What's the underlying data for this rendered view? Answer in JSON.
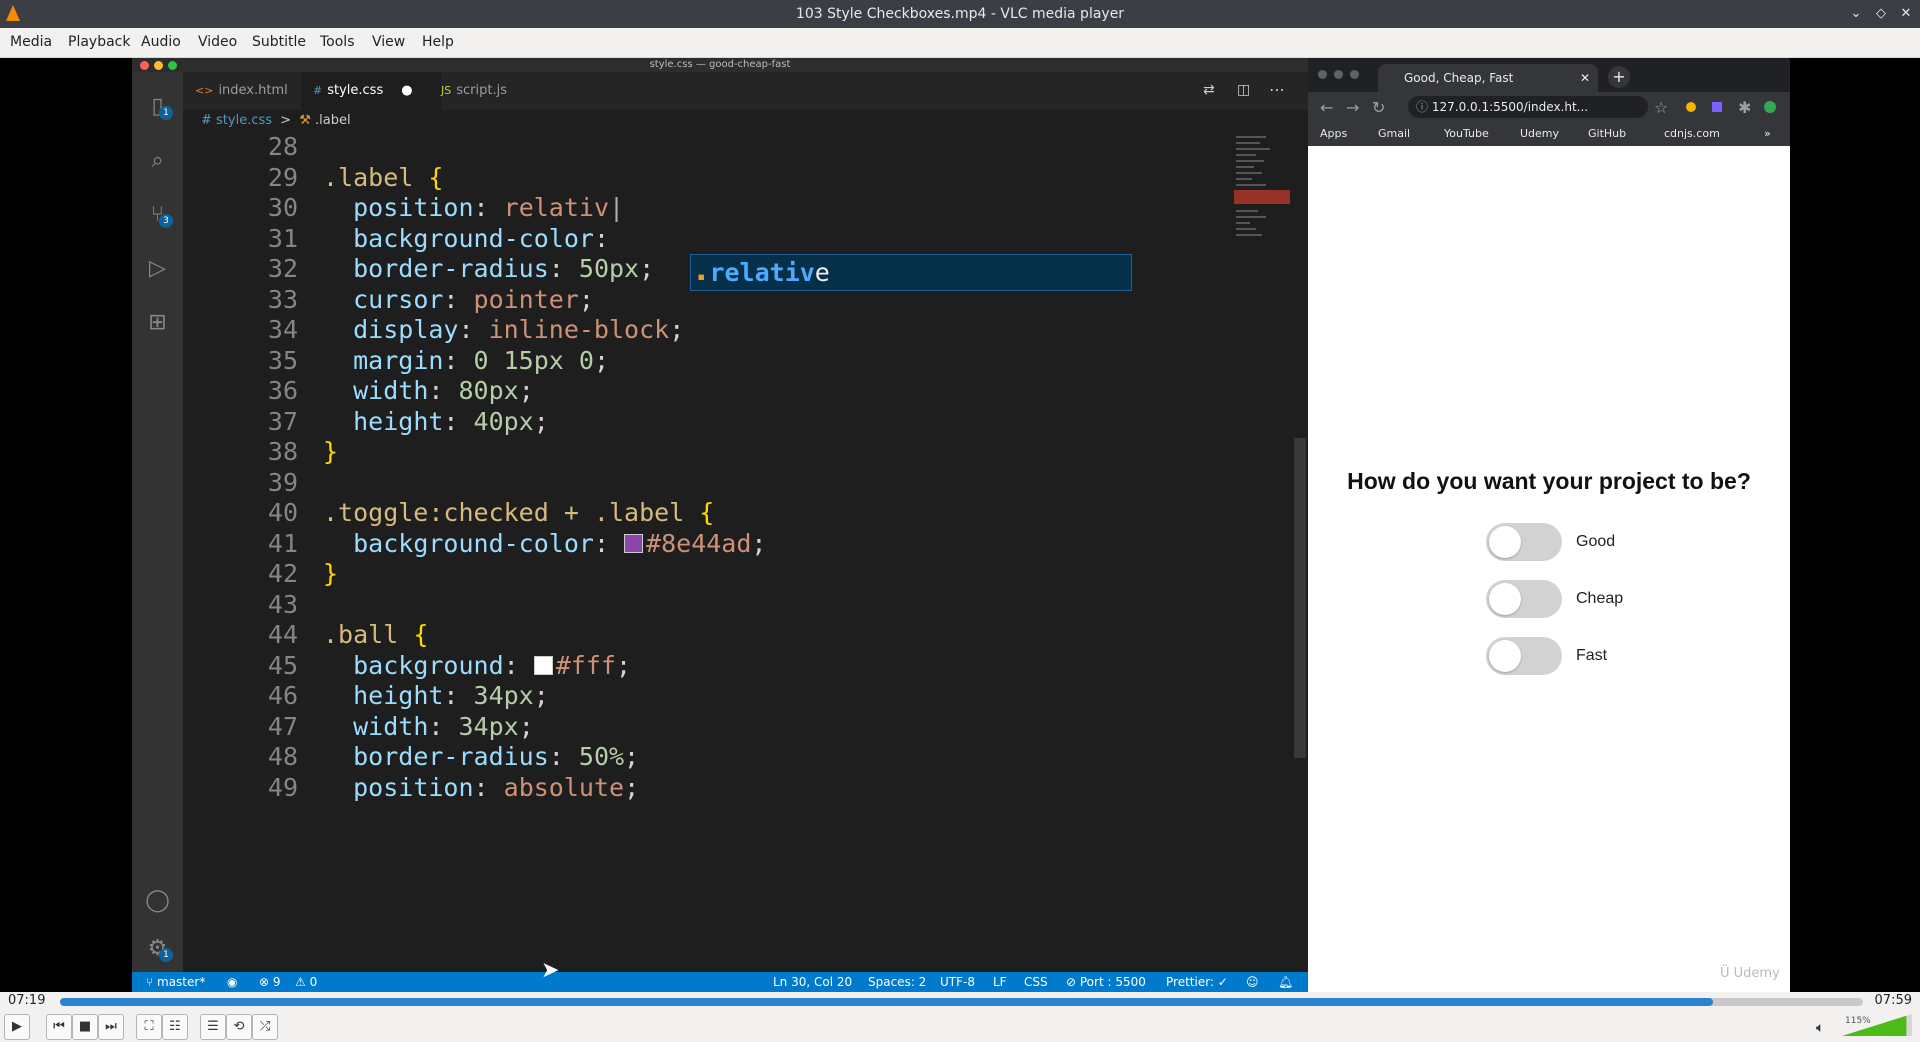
{
  "window": {
    "title": "103 Style Checkboxes.mp4 - VLC media player"
  },
  "menu": [
    "Media",
    "Playback",
    "Audio",
    "Video",
    "Subtitle",
    "Tools",
    "View",
    "Help"
  ],
  "vscode": {
    "title": "style.css — good-cheap-fast",
    "tabs": [
      {
        "icon": "<>",
        "label": "index.html"
      },
      {
        "icon": "#",
        "label": "style.css"
      },
      {
        "icon": "JS",
        "label": "script.js"
      }
    ],
    "breadcrumb": {
      "file": "# style.css",
      "sep": ">",
      "symbol": ".label"
    },
    "activity_badges": {
      "explorer": "1",
      "scm": "3",
      "settings": "1"
    },
    "line_numbers": [
      "28",
      "29",
      "30",
      "31",
      "32",
      "33",
      "34",
      "35",
      "36",
      "37",
      "38",
      "39",
      "40",
      "41",
      "42",
      "43",
      "44",
      "45",
      "46",
      "47",
      "48",
      "49"
    ],
    "code": {
      "l29_sel": ".label",
      "l29_brace": " {",
      "l30_prop": "position",
      "l30_punc": ": ",
      "l30_val": "relativ",
      "l31_prop": "background-color",
      "l31_punc": ":",
      "l32_prop": "border-radius",
      "l32_punc": ": ",
      "l32_val": "50px",
      "l32_end": ";",
      "l33_prop": "cursor",
      "l33_punc": ": ",
      "l33_val": "pointer",
      "l33_end": ";",
      "l34_prop": "display",
      "l34_punc": ": ",
      "l34_val": "inline-block",
      "l34_end": ";",
      "l35_prop": "margin",
      "l35_punc": ": ",
      "l35_val": "0 15px 0",
      "l35_end": ";",
      "l36_prop": "width",
      "l36_punc": ": ",
      "l36_val": "80px",
      "l36_end": ";",
      "l37_prop": "height",
      "l37_punc": ": ",
      "l37_val": "40px",
      "l37_end": ";",
      "l38_brace": "}",
      "l40_sel": ".toggle:checked + .label",
      "l40_brace": " {",
      "l41_prop": "background-color",
      "l41_punc": ": ",
      "l41_val": "#8e44ad",
      "l41_end": ";",
      "l42_brace": "}",
      "l44_sel": ".ball",
      "l44_brace": " {",
      "l45_prop": "background",
      "l45_punc": ": ",
      "l45_val": "#fff",
      "l45_end": ";",
      "l46_prop": "height",
      "l46_punc": ": ",
      "l46_val": "34px",
      "l46_end": ";",
      "l47_prop": "width",
      "l47_punc": ": ",
      "l47_val": "34px",
      "l47_end": ";",
      "l48_prop": "border-radius",
      "l48_punc": ": ",
      "l48_val": "50%",
      "l48_end": ";",
      "l49_prop": "position",
      "l49_punc": ": ",
      "l49_val": "absolute",
      "l49_end": ";"
    },
    "swatch_colors": {
      "purple": "#8e44ad",
      "white": "#ffffff"
    },
    "suggestion": {
      "match": "relativ",
      "rest": "e"
    },
    "status": {
      "branch": "master*",
      "errors": "⊗ 9",
      "warnings": "⚠ 0",
      "position": "Ln 30, Col 20",
      "spaces": "Spaces: 2",
      "encoding": "UTF-8",
      "eol": "LF",
      "language": "CSS",
      "port": "⊘ Port : 5500",
      "prettier": "Prettier: ✓"
    }
  },
  "browser": {
    "tab_title": "Good, Cheap, Fast",
    "url": "127.0.0.1:5500/index.ht...",
    "bookmarks": [
      "Apps",
      "Gmail",
      "YouTube",
      "Udemy",
      "GitHub",
      "cdnjs.com"
    ],
    "page": {
      "question": "How do you want your project to be?",
      "toggles": [
        {
          "label": "Good",
          "checked": false
        },
        {
          "label": "Cheap",
          "checked": false
        },
        {
          "label": "Fast",
          "checked": false
        }
      ]
    },
    "watermark": "Udemy"
  },
  "player": {
    "current_time": "07:19",
    "total_time": "07:59",
    "progress_fraction": 0.917,
    "volume": "115%"
  }
}
